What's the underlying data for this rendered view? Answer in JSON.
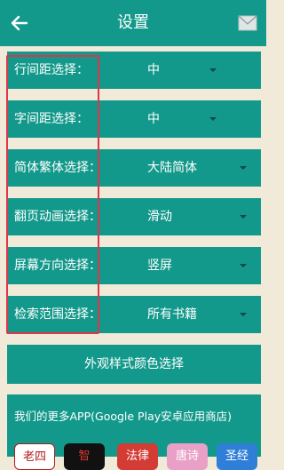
{
  "header": {
    "title": "设置",
    "back_icon": "back-arrow-icon",
    "mail_icon": "mail-icon"
  },
  "settings": [
    {
      "label": "行间距选择：",
      "value": "中"
    },
    {
      "label": "字间距选择：",
      "value": "中"
    },
    {
      "label": "简体繁体选择：",
      "value": "大陆简体"
    },
    {
      "label": "翻页动画选择：",
      "value": "滑动"
    },
    {
      "label": "屏幕方向选择：",
      "value": "竖屏"
    },
    {
      "label": "检索范围选择：",
      "value": "所有书籍"
    }
  ],
  "color_button": "外观样式颜色选择",
  "apps": {
    "title": "我们的更多APP(Google Play安卓应用商店)",
    "icons": [
      "老四",
      "智",
      "法律",
      "唐诗",
      "圣经"
    ]
  },
  "colors": {
    "primary": "#13998b",
    "background": "#f2ead8",
    "highlight": "#d8384a"
  }
}
